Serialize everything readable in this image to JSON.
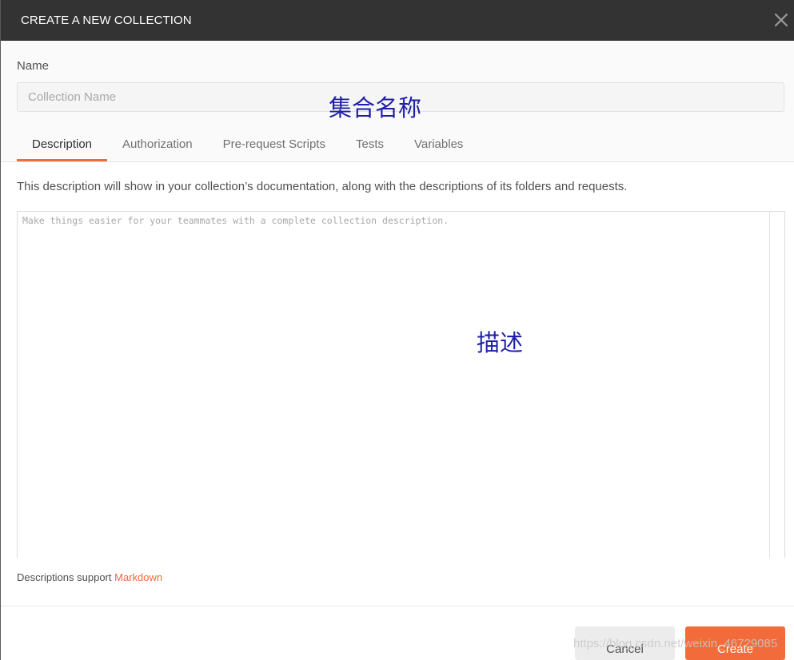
{
  "dialog": {
    "title": "CREATE A NEW COLLECTION",
    "close_icon": "close-icon"
  },
  "name_field": {
    "label": "Name",
    "placeholder": "Collection Name",
    "value": ""
  },
  "annotations": {
    "name": "集合名称",
    "description": "描述"
  },
  "tabs": [
    {
      "label": "Description",
      "active": true
    },
    {
      "label": "Authorization",
      "active": false
    },
    {
      "label": "Pre-request Scripts",
      "active": false
    },
    {
      "label": "Tests",
      "active": false
    },
    {
      "label": "Variables",
      "active": false
    }
  ],
  "description": {
    "help_text": "This description will show in your collection’s documentation, along with the descriptions of its folders and requests.",
    "placeholder": "Make things easier for your teammates with a complete collection description.",
    "value": ""
  },
  "markdown_note": {
    "prefix": "Descriptions support ",
    "link": "Markdown"
  },
  "footer": {
    "cancel_label": "Cancel",
    "create_label": "Create"
  },
  "watermark": "https://blog.csdn.net/weixin_46729085",
  "colors": {
    "header_bg": "#333333",
    "accent": "#f26b3a",
    "annotation": "#1f1fa8"
  }
}
